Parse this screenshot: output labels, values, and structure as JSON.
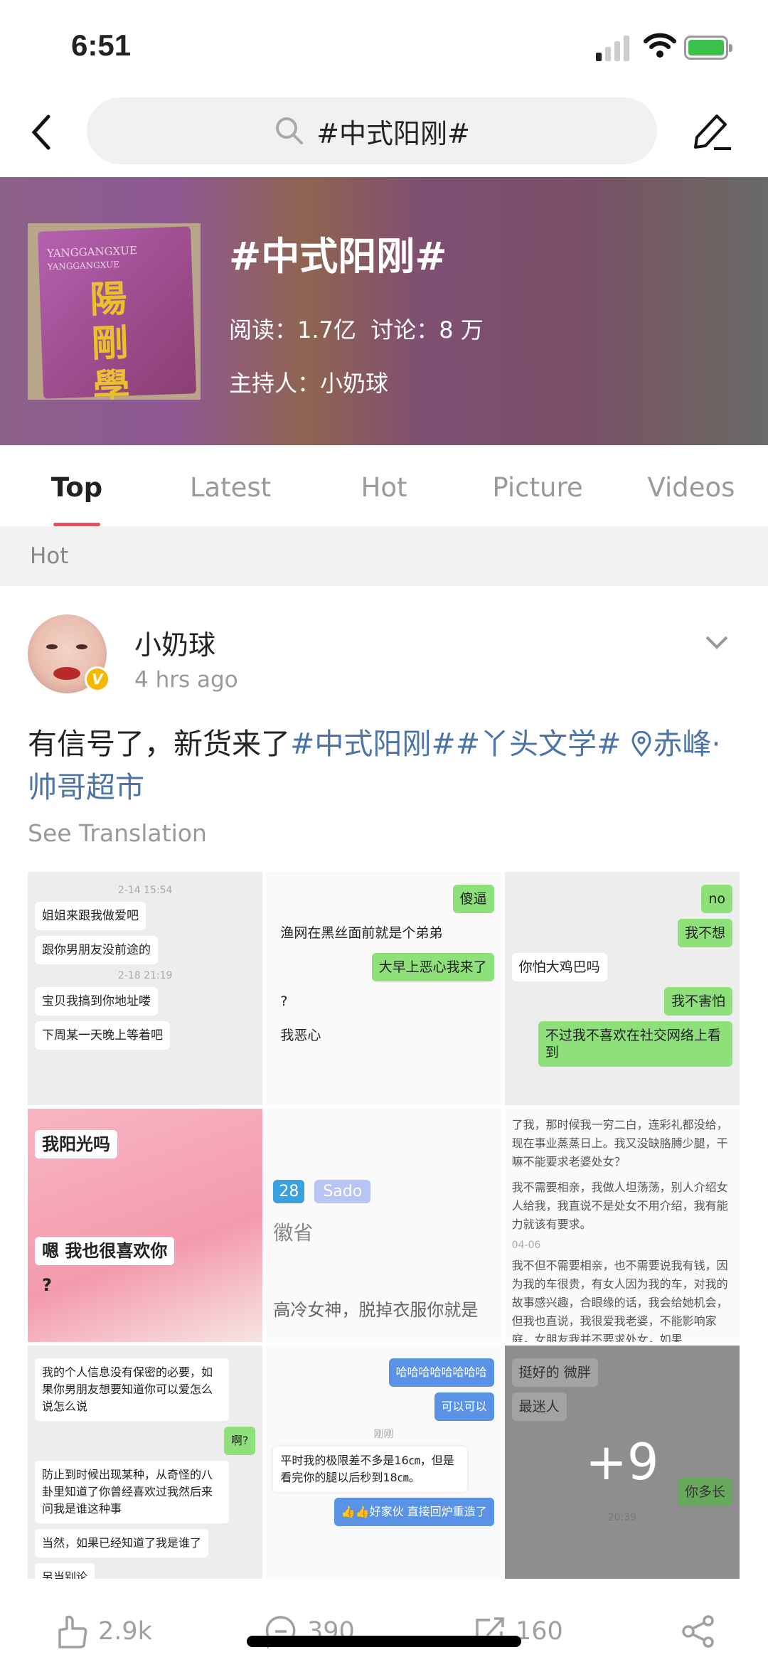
{
  "status_bar": {
    "time": "6:51",
    "battery": "charging",
    "icons": [
      "signal-icon",
      "wifi-icon",
      "battery-icon"
    ]
  },
  "nav": {
    "search_value": "#中式阳刚#",
    "icons": [
      "back-icon",
      "search-icon",
      "edit-icon"
    ]
  },
  "topic": {
    "cover_logo_text": {
      "en": "YANGGANGXUE",
      "zh": "陽剛學"
    },
    "title": "#中式阳刚#",
    "stats": "阅读：1.7亿  讨论：8 万",
    "host": "主持人：小奶球"
  },
  "tabs": [
    {
      "label": "Top",
      "active": true
    },
    {
      "label": "Latest"
    },
    {
      "label": "Hot"
    },
    {
      "label": "Picture"
    },
    {
      "label": "Videos"
    }
  ],
  "section": {
    "label": "Hot"
  },
  "post": {
    "author": "小奶球",
    "verified": true,
    "time": "4 hrs ago",
    "text_plain": "有信号了，新货来了",
    "tags": "#中式阳刚##丫头文学#",
    "location": "赤峰·帅哥超市",
    "see_translation": "See Translation",
    "images": [
      {
        "bubbles": [
          "2-14 15:54",
          "姐姐来跟我做爱吧",
          "跟你男朋友没前途的",
          "2-18 21:19",
          "宝贝我搞到你地址喽",
          "下周某一天晚上等着吧"
        ]
      },
      {
        "bubbles": [
          "傻逼",
          "渔网在黑丝面前就是个弟弟",
          "大早上恶心我来了",
          "?",
          "我恶心"
        ]
      },
      {
        "bubbles": [
          "no",
          "我不想",
          "你怕大鸡巴吗",
          "我不害怕",
          "不过我不喜欢在社交网络上看到"
        ]
      },
      {
        "bubbles": [
          "我阳光吗",
          "嗯 我也很喜欢你",
          "?"
        ]
      },
      {
        "bubbles": [
          "28",
          "Sado",
          "徽省",
          "高冷女神，脱掉衣服你就是"
        ]
      },
      {
        "bubbles": [
          "了我，那时候我一穷二白，连彩礼都没给，现在事业蒸蒸日上。我又没缺胳膊少腿，干嘛不能要求老婆处女？",
          "我不需要相亲，我做人坦荡荡，别人介绍女人给我，我直说不是处女不用介绍，我有能力就该有要求。",
          "04-06",
          "我不但不需要相亲，也不需要说我有钱，因为我的车很贵，有女人因为我的车，对我的故事感兴趣，合眼缘的话，我会给她机会，但我也直说，我很爱我老婆，不能影响家庭，女朋友我并不要求处女，如果"
        ]
      },
      {
        "bubbles": [
          "我的个人信息没有保密的必要，如果你男朋友想要知道你可以爱怎么说怎么说",
          "啊?",
          "防止到时候出现某种，从奇怪的八卦里知道了你曾经喜欢过我然后来问我是谁这种事",
          "当然，如果已经知道了我是谁了",
          "另当别论"
        ]
      },
      {
        "bubbles": [
          "哈哈哈哈哈哈哈哈",
          "可以可以",
          "刚刚",
          "平时我的极限差不多是16㎝，但是看完你的腿以后秒到18㎝。",
          "👍👍好家伙 直接回炉重造了"
        ]
      },
      {
        "bubbles": [
          "挺好的 微胖",
          "最迷人",
          "你多长",
          "20:39"
        ],
        "more_count": "+9"
      }
    ],
    "actions": {
      "likes": "2.9k",
      "comments": "390",
      "reposts": "160"
    }
  },
  "colors": {
    "accent": "#ef4b5c",
    "link": "#4d74a8",
    "muted": "#999999"
  }
}
